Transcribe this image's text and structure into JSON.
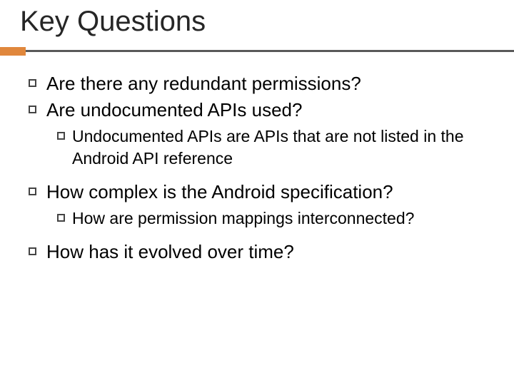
{
  "title": "Key Questions",
  "items": {
    "i0": "Are there any redundant permissions?",
    "i1": "Are undocumented APIs used?",
    "i1_sub": "Undocumented APIs are APIs that are not listed in the Android API reference",
    "i2": "How complex is the Android specification?",
    "i2_sub": "How are permission mappings interconnected?",
    "i3": "How has it evolved over time?"
  }
}
